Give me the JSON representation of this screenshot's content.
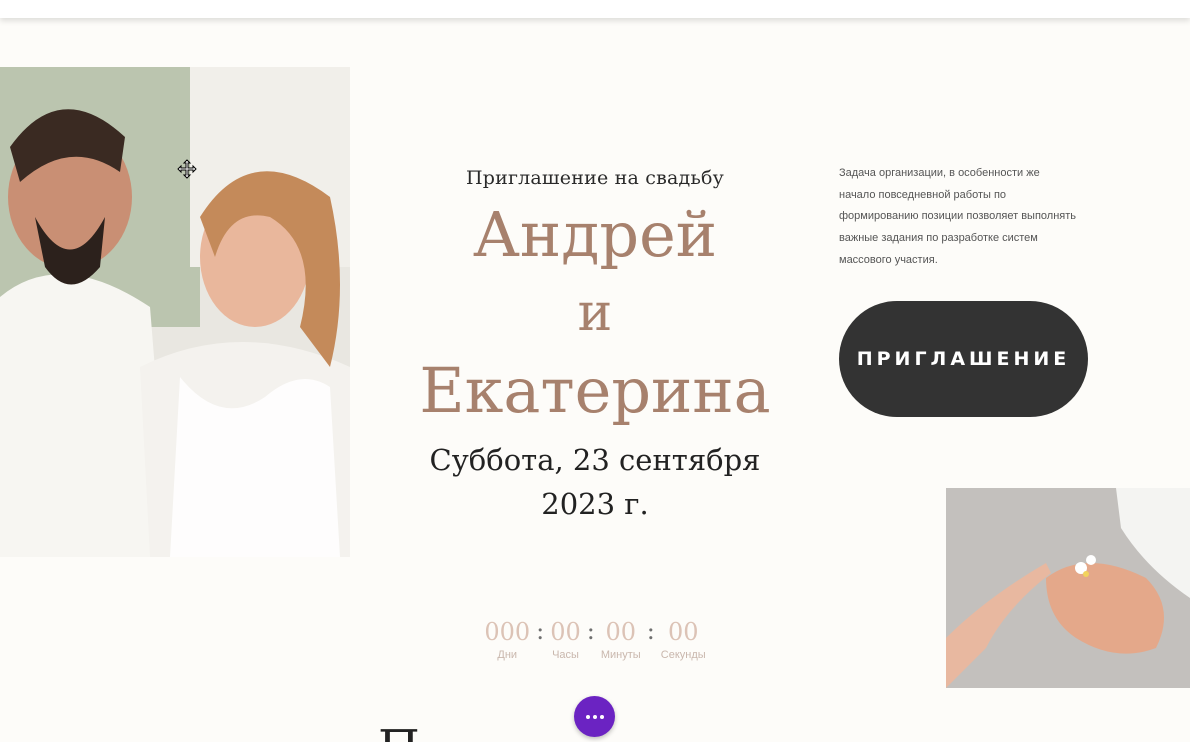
{
  "hero": {
    "subtitle": "Приглашение на свадьбу",
    "name_groom": "Андрей",
    "name_and": "и",
    "name_bride": "Екатерина",
    "date_line1": "Суббота, 23 сентября",
    "date_line2": "2023 г."
  },
  "countdown": {
    "days": "000",
    "days_label": "Дни",
    "hours": "00",
    "hours_label": "Часы",
    "minutes": "00",
    "minutes_label": "Минуты",
    "seconds": "00",
    "seconds_label": "Секунды",
    "separator": ":"
  },
  "side": {
    "text": "Задача организации, в особенности же начало повседневной работы по формированию позиции позволяет выполнять важные задания по разработке систем массового участия.",
    "button_label": "ПРИГЛАШЕНИЕ"
  },
  "bottom": {
    "heading_partial": "П"
  },
  "icons": {
    "cursor": "move-cursor-icon",
    "fab": "more-dots-icon"
  },
  "colors": {
    "accent": "#a7816d",
    "button_bg": "#333333",
    "fab_bg": "#6b23c2",
    "countdown": "#dcc3b6"
  }
}
